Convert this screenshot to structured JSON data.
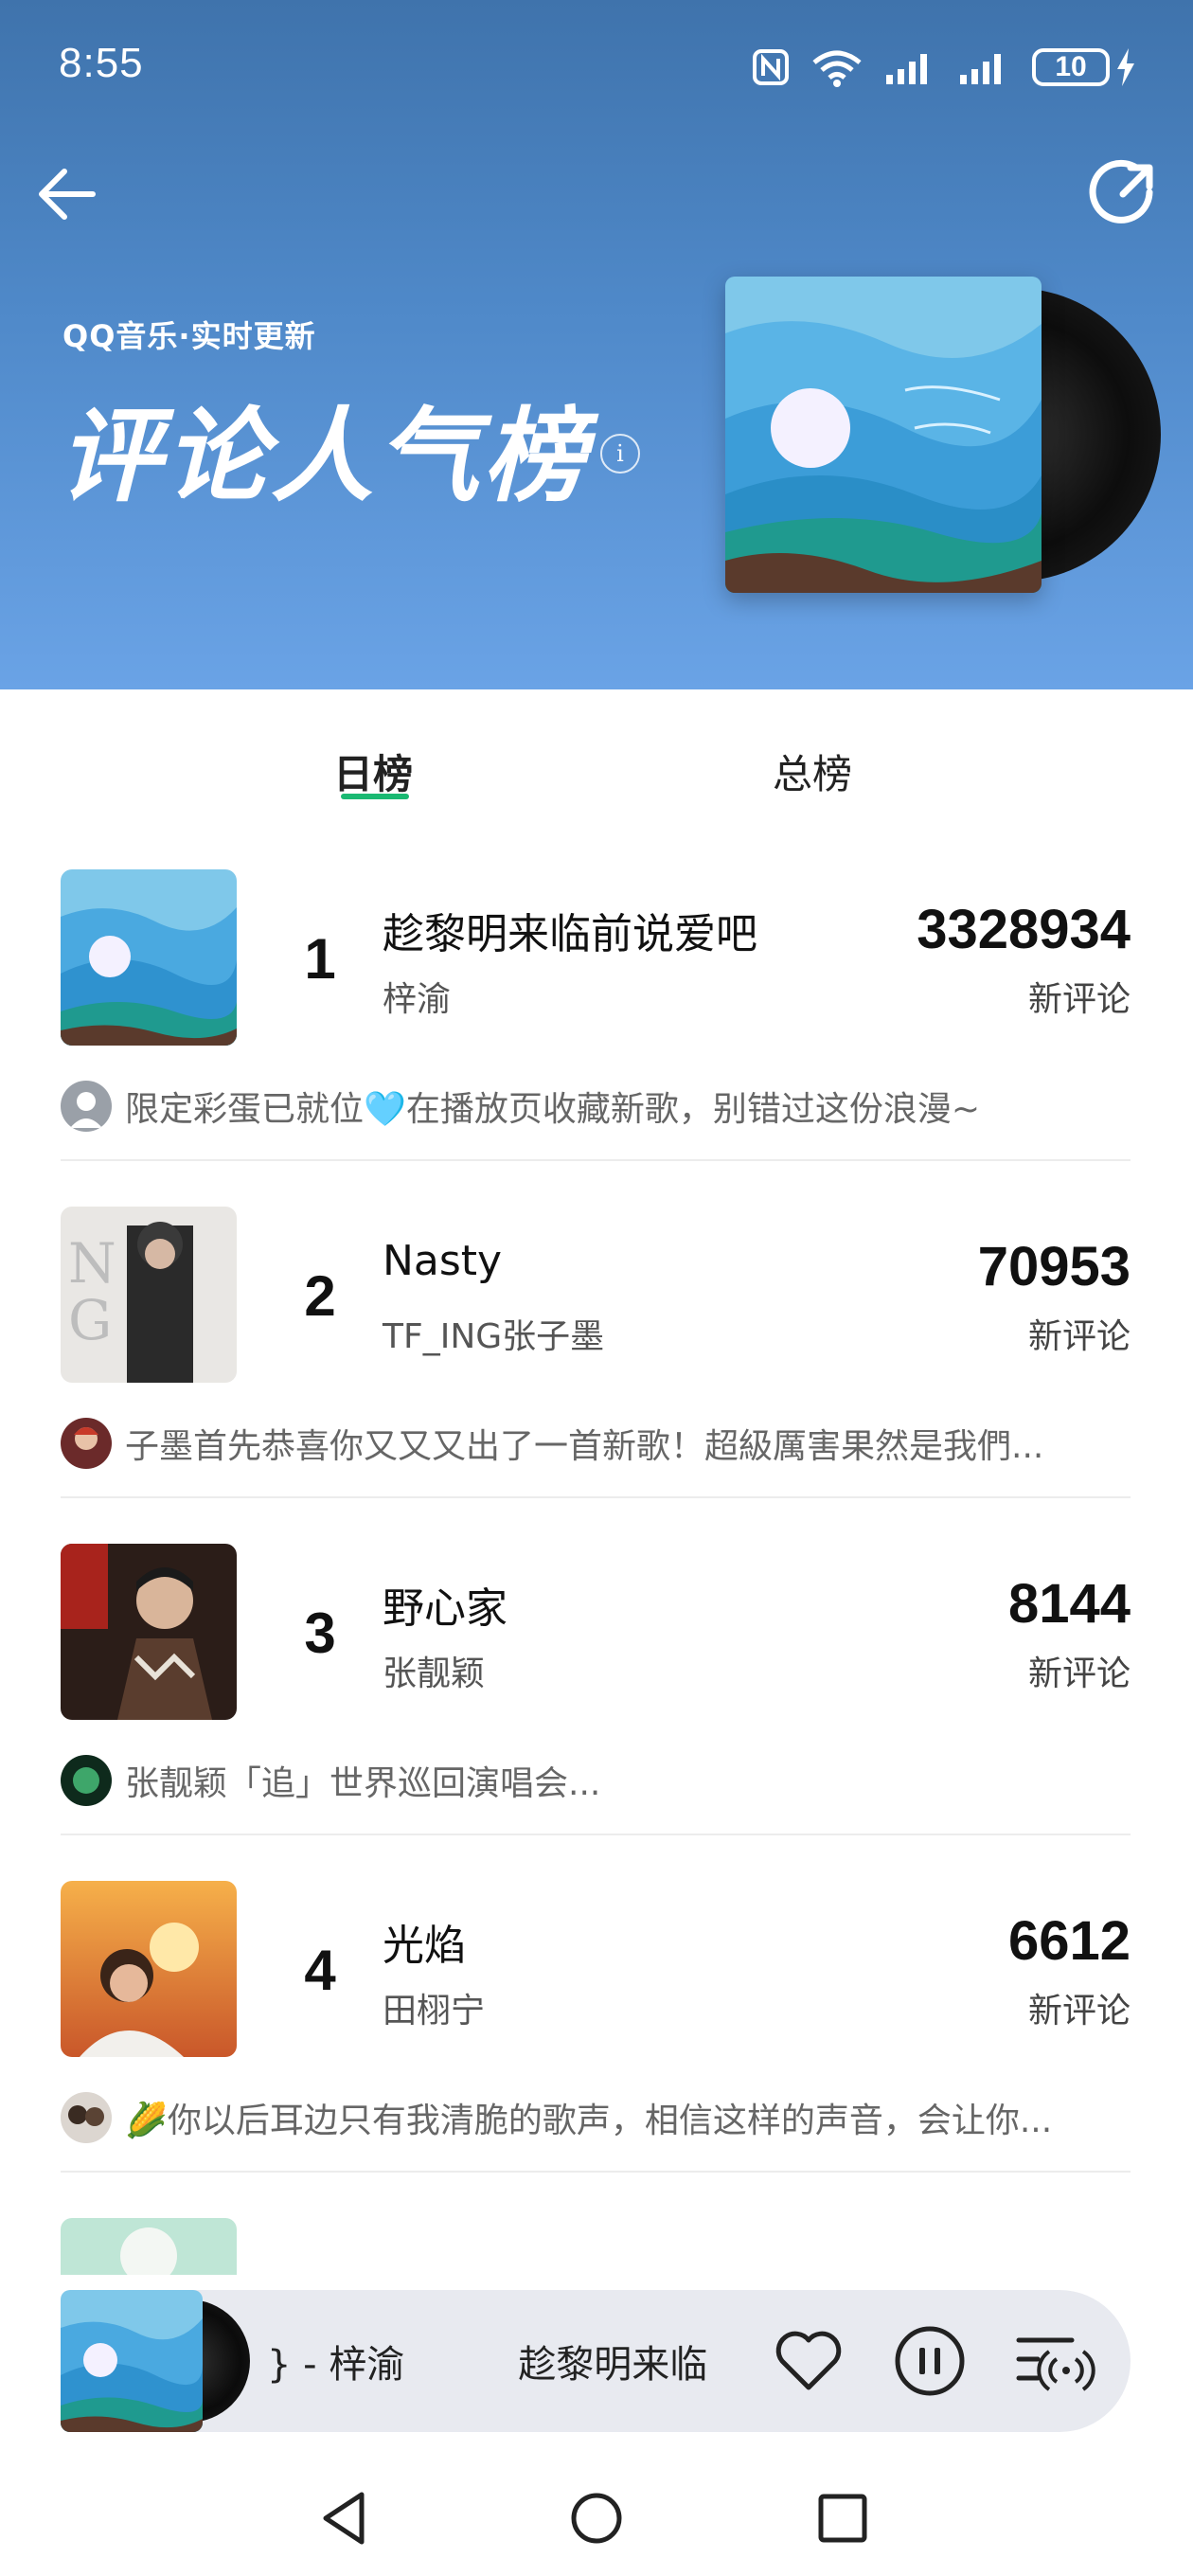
{
  "status_bar": {
    "time": "8:55",
    "battery": "10"
  },
  "header": {
    "brand_line": "QQ音乐·实时更新",
    "title": "评论人气榜",
    "info_label": "i"
  },
  "tabs": [
    {
      "label": "日榜",
      "active": true
    },
    {
      "label": "总榜",
      "active": false
    }
  ],
  "list": [
    {
      "rank": "1",
      "title": "趁黎明来临前说爱吧",
      "artist": "梓渝",
      "count": "3328934",
      "count_label": "新评论",
      "comment": "限定彩蛋已就位🩵在播放页收藏新歌，别错过这份浪漫~"
    },
    {
      "rank": "2",
      "title": "Nasty",
      "artist": "TF_ING张子墨",
      "count": "70953",
      "count_label": "新评论",
      "comment": "子墨首先恭喜你又又又出了一首新歌！超級厲害果然是我們..."
    },
    {
      "rank": "3",
      "title": "野心家",
      "artist": "张靓颖",
      "count": "8144",
      "count_label": "新评论",
      "comment": "张靓颖「追」世界巡回演唱会..."
    },
    {
      "rank": "4",
      "title": "光焰",
      "artist": "田栩宁",
      "count": "6612",
      "count_label": "新评论",
      "comment": "🌽你以后耳边只有我清脆的歌声，相信这样的声音，会让你..."
    }
  ],
  "player": {
    "artist_segment": "} - 梓渝",
    "title_segment": "趁黎明来临"
  },
  "colors": {
    "accent": "#1ab972",
    "header_top": "#3f73ac",
    "header_bottom": "#6aa3e6"
  },
  "icons": [
    "back-arrow-icon",
    "share-icon",
    "info-icon",
    "heart-icon",
    "pause-icon",
    "playlist-icon",
    "nav-back-icon",
    "nav-home-icon",
    "nav-recents-icon"
  ]
}
